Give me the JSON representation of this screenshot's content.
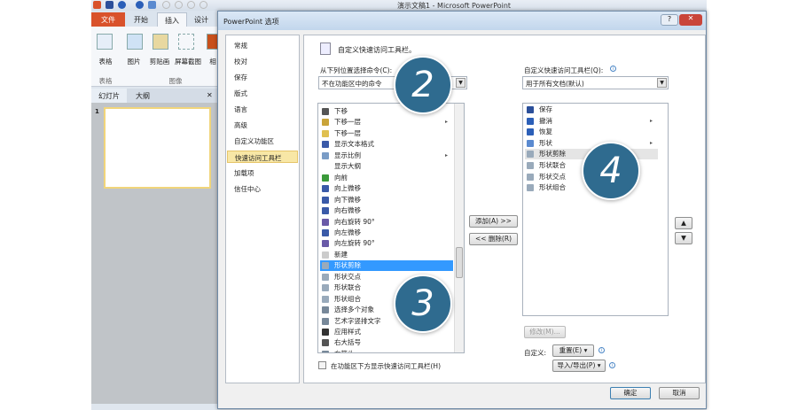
{
  "app": {
    "title": "演示文稿1 - Microsoft PowerPoint",
    "tabs": [
      "文件",
      "开始",
      "插入",
      "设计"
    ],
    "active_tab": "插入",
    "ribbon": {
      "buttons": [
        "表格",
        "图片",
        "剪贴画",
        "屏幕截图",
        "相"
      ],
      "groups": [
        "表格",
        "图像"
      ]
    },
    "pane_tabs": [
      "幻灯片",
      "大纲"
    ],
    "pane_close": "✕",
    "slide_number": "1"
  },
  "dialog": {
    "title": "PowerPoint 选项",
    "help": "?",
    "close": "✕",
    "nav": [
      "常规",
      "校对",
      "保存",
      "版式",
      "语言",
      "高级",
      "自定义功能区",
      "快速访问工具栏",
      "加载项",
      "信任中心"
    ],
    "nav_selected": 7,
    "header": "自定义快速访问工具栏。",
    "choose_label": "从下列位置选择命令(C):",
    "choose_value": "不在功能区中的命令",
    "commands": [
      {
        "label": "下移",
        "icon": "arrow-down-icon",
        "color": "#555"
      },
      {
        "label": "下移一层",
        "icon": "send-backward-icon",
        "color": "#c9a43a",
        "submenu": true
      },
      {
        "label": "下移一层",
        "icon": "send-backward-icon",
        "color": "#e0c050"
      },
      {
        "label": "显示文本格式",
        "icon": "text-format-icon",
        "color": "#3a5aa8"
      },
      {
        "label": "显示比例",
        "icon": "zoom-icon",
        "color": "#7a9cc6",
        "submenu": true
      },
      {
        "label": "显示大纲",
        "icon": "",
        "color": ""
      },
      {
        "label": "向前",
        "icon": "forward-icon",
        "color": "#3a9a3a"
      },
      {
        "label": "向上微移",
        "icon": "nudge-up-icon",
        "color": "#3a5aa8"
      },
      {
        "label": "向下微移",
        "icon": "nudge-down-icon",
        "color": "#3a5aa8"
      },
      {
        "label": "向右微移",
        "icon": "nudge-right-icon",
        "color": "#3a5aa8"
      },
      {
        "label": "向右旋转 90°",
        "icon": "rotate-right-icon",
        "color": "#6a5aa8"
      },
      {
        "label": "向左微移",
        "icon": "nudge-left-icon",
        "color": "#3a5aa8"
      },
      {
        "label": "向左旋转 90°",
        "icon": "rotate-left-icon",
        "color": "#6a5aa8"
      },
      {
        "label": "新建",
        "icon": "new-document-icon",
        "color": "#ccc"
      },
      {
        "label": "形状剪除",
        "icon": "shape-subtract-icon",
        "color": "#9ab"
      },
      {
        "label": "形状交点",
        "icon": "shape-intersect-icon",
        "color": "#9ab"
      },
      {
        "label": "形状联合",
        "icon": "shape-union-icon",
        "color": "#9ab"
      },
      {
        "label": "形状组合",
        "icon": "shape-combine-icon",
        "color": "#9ab"
      },
      {
        "label": "选择多个对象",
        "icon": "select-objects-icon",
        "color": "#789"
      },
      {
        "label": "艺术字竖排文字",
        "icon": "wordart-vertical-icon",
        "color": "#789"
      },
      {
        "label": "应用样式",
        "icon": "apply-style-icon",
        "color": "#333"
      },
      {
        "label": "右大括号",
        "icon": "right-brace-icon",
        "color": "#555"
      },
      {
        "label": "右箭头",
        "icon": "right-arrow-icon",
        "color": "#789"
      }
    ],
    "commands_selected": 14,
    "add_button": "添加(A) >>",
    "remove_button": "<< 删除(R)",
    "qat_label": "自定义快速访问工具栏(Q):",
    "qat_value": "用于所有文档(默认)",
    "qat_items": [
      {
        "label": "保存",
        "icon": "save-icon",
        "color": "#2b4f9a"
      },
      {
        "label": "撤消",
        "icon": "undo-icon",
        "color": "#2b5fb8",
        "submenu": true
      },
      {
        "label": "恢复",
        "icon": "redo-icon",
        "color": "#2b5fb8"
      },
      {
        "label": "形状",
        "icon": "shapes-icon",
        "color": "#5a8ad0",
        "submenu": true
      },
      {
        "label": "形状剪除",
        "icon": "shape-subtract-icon",
        "color": "#9ab"
      },
      {
        "label": "形状联合",
        "icon": "shape-union-icon",
        "color": "#9ab"
      },
      {
        "label": "形状交点",
        "icon": "shape-intersect-icon",
        "color": "#9ab"
      },
      {
        "label": "形状组合",
        "icon": "shape-combine-icon",
        "color": "#9ab"
      }
    ],
    "qat_highlighted": 4,
    "modify_button": "修改(M)...",
    "customize_label": "自定义:",
    "reset_button": "重置(E) ▾",
    "import_export_button": "导入/导出(P) ▾",
    "show_below_checkbox": "在功能区下方显示快速访问工具栏(H)",
    "show_below_checked": false,
    "ok_button": "确定",
    "cancel_button": "取消",
    "step_markers": [
      "2",
      "3",
      "4"
    ],
    "marker_color": "#2f6b8f"
  }
}
